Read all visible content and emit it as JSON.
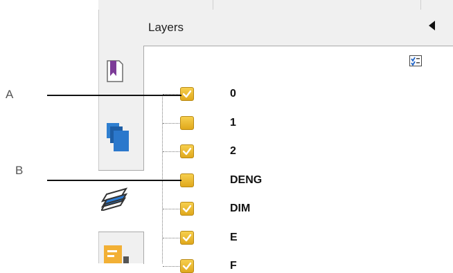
{
  "panel": {
    "title": "Layers"
  },
  "icons": {
    "collapse": "triangle-left-icon",
    "options": "layer-options-icon",
    "bookmarks": "bookmark-icon",
    "pages": "pages-icon",
    "layers": "layers-icon",
    "comments": "comment-icon"
  },
  "layers": [
    {
      "name": "0",
      "checked": true
    },
    {
      "name": "1",
      "checked": false
    },
    {
      "name": "2",
      "checked": true
    },
    {
      "name": "DENG",
      "checked": false
    },
    {
      "name": "DIM",
      "checked": true
    },
    {
      "name": "E",
      "checked": true
    },
    {
      "name": "F",
      "checked": true
    }
  ],
  "callouts": {
    "a": "A",
    "b": "B"
  },
  "colors": {
    "checkbox": "#e8b52a",
    "active_layers_icon": "#2b7bd3"
  }
}
